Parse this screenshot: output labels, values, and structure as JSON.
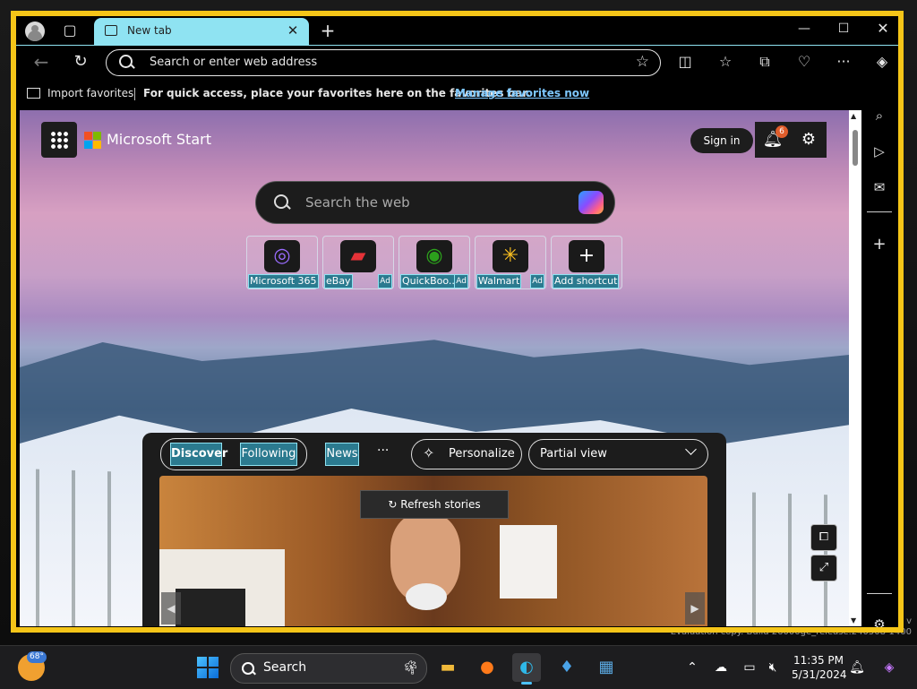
{
  "window": {
    "tab_title": "New tab",
    "address_placeholder": "Search or enter web address"
  },
  "favorites_bar": {
    "import_label": "Import favorites",
    "message": "For quick access, place your favorites here on the favorites bar.",
    "manage_link": "Manage favorites now"
  },
  "start_page": {
    "brand": "Microsoft Start",
    "sign_in": "Sign in",
    "notification_count": "6",
    "search_placeholder": "Search the web",
    "shortcuts": [
      {
        "label": "Microsoft 365",
        "ad": ""
      },
      {
        "label": "eBay",
        "ad": "Ad"
      },
      {
        "label": "QuickBoo...",
        "ad": "Ad"
      },
      {
        "label": "Walmart",
        "ad": "Ad"
      },
      {
        "label": "Add shortcut",
        "ad": ""
      }
    ],
    "feed": {
      "tabs": [
        "Discover",
        "Following",
        "News"
      ],
      "more": "···",
      "personalize": "Personalize",
      "view_select": "Partial view",
      "refresh": "Refresh stories"
    }
  },
  "watermark": {
    "line1": "v",
    "line2": "Evaluation copy. Build 26000ge_release.240508-1400"
  },
  "taskbar": {
    "temperature": "68°",
    "search_label": "Search",
    "time": "11:35 PM",
    "date": "5/31/2024"
  },
  "colors": {
    "window_border": "#f5c518",
    "tab_active": "#8fe3f2",
    "link": "#7ec8ff",
    "notification_badge": "#e05d2b"
  }
}
